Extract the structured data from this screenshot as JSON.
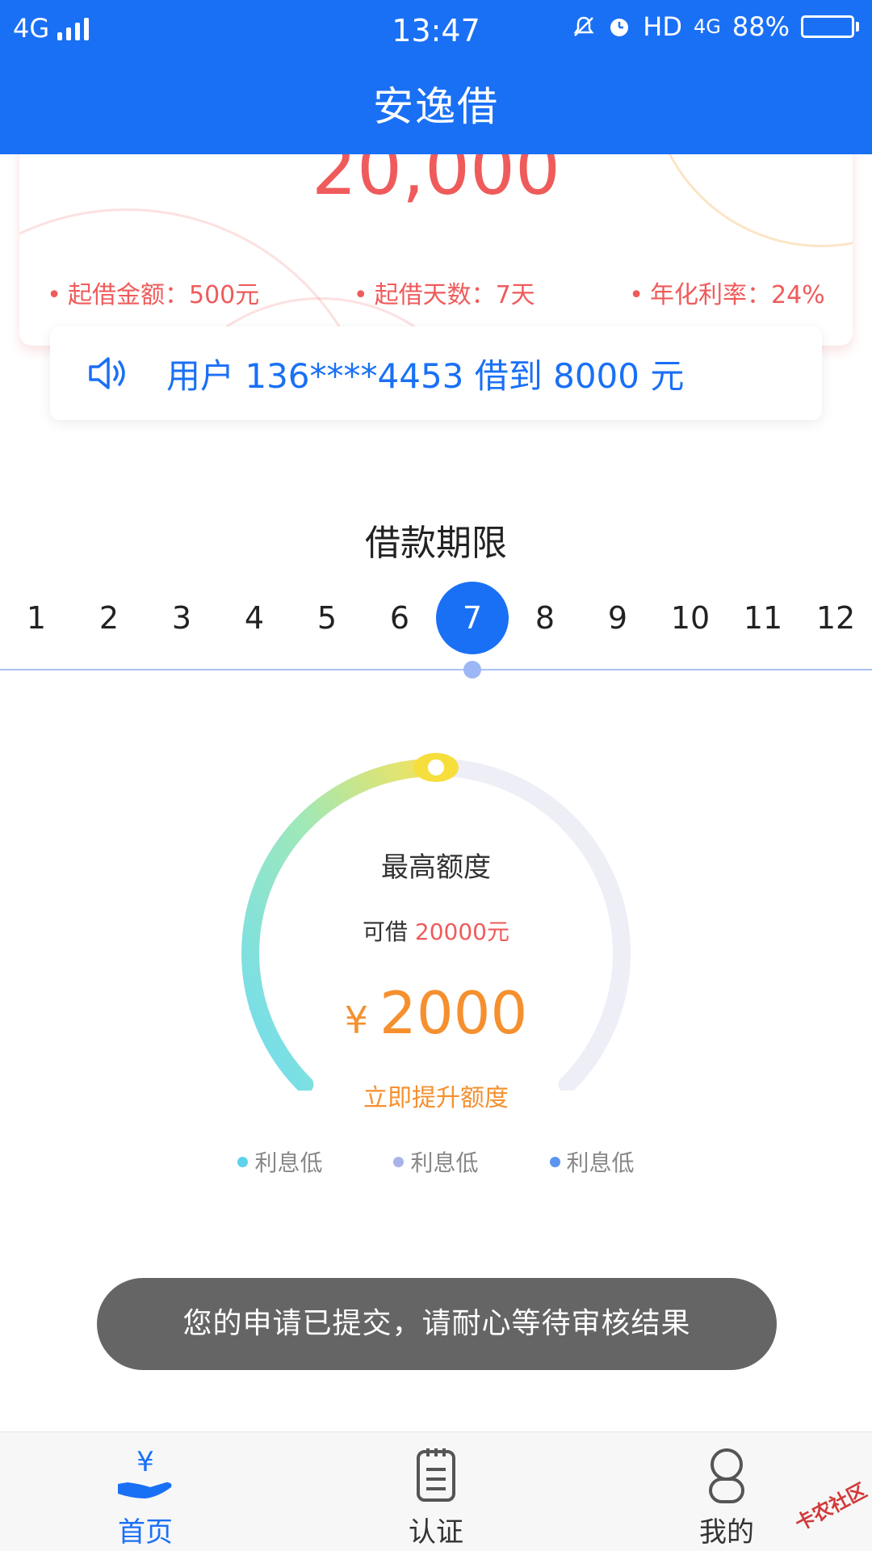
{
  "status_bar": {
    "network": "4G",
    "time": "13:47",
    "hd": "HD",
    "net2": "4G",
    "battery_percent": "88%",
    "battery_level": 0.88
  },
  "app_title": "安逸借",
  "top_card": {
    "amount": "20,000",
    "features": [
      "起借金额：500元",
      "起借天数：7天",
      "年化利率：24%"
    ]
  },
  "notice": {
    "text": "用户 136****4453 借到 8000 元"
  },
  "period": {
    "title": "借款期限",
    "options": [
      "1",
      "2",
      "3",
      "4",
      "5",
      "6",
      "7",
      "8",
      "9",
      "10",
      "11",
      "12"
    ],
    "selected_index": 6
  },
  "gauge": {
    "title": "最高额度",
    "sub_prefix": "可借",
    "sub_amount": "20000元",
    "currency": "¥",
    "value": "2000",
    "boost": "立即提升额度",
    "fraction": 0.5
  },
  "legend": [
    {
      "label": "利息低",
      "color": "#5ed2ea"
    },
    {
      "label": "利息低",
      "color": "#a9b3e8"
    },
    {
      "label": "利息低",
      "color": "#5c95f0"
    }
  ],
  "toast": "您的申请已提交，请耐心等待审核结果",
  "bottom_nav": {
    "home": "首页",
    "auth": "认证",
    "me": "我的"
  },
  "watermark": "卡农社区",
  "colors": {
    "primary": "#1a70f5",
    "red": "#ef5b5b",
    "orange": "#f5902f"
  }
}
